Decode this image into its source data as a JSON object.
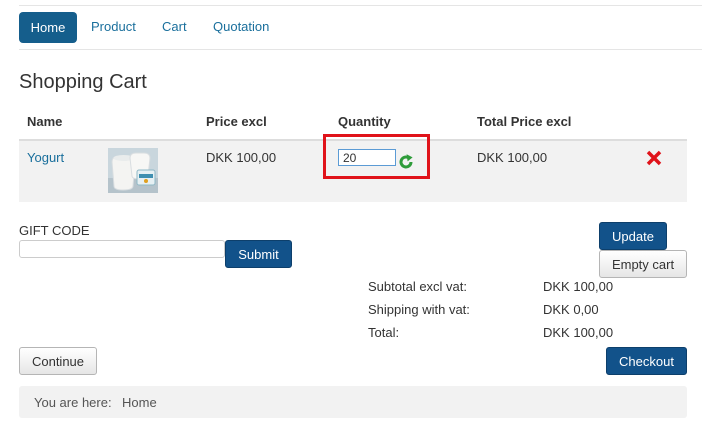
{
  "nav": {
    "items": [
      {
        "label": "Home"
      },
      {
        "label": "Product"
      },
      {
        "label": "Cart"
      },
      {
        "label": "Quotation"
      }
    ]
  },
  "page_title": "Shopping Cart",
  "table": {
    "headers": {
      "name": "Name",
      "price": "Price excl",
      "quantity": "Quantity",
      "total": "Total Price excl"
    },
    "rows": [
      {
        "name": "Yogurt",
        "image_icon": "yogurt-product-photo",
        "price": "DKK 100,00",
        "quantity": "20",
        "total": "DKK 100,00"
      }
    ]
  },
  "gift": {
    "label": "GIFT CODE",
    "value": "",
    "submit_label": "Submit"
  },
  "actions": {
    "update_label": "Update",
    "empty_label": "Empty cart",
    "continue_label": "Continue",
    "checkout_label": "Checkout"
  },
  "summary": {
    "subtotal_label": "Subtotal excl vat:",
    "subtotal_value": "DKK 100,00",
    "shipping_label": "Shipping with vat:",
    "shipping_value": "DKK 0,00",
    "total_label": "Total:",
    "total_value": "DKK 100,00"
  },
  "breadcrumb": {
    "prefix": "You are here:",
    "home": "Home"
  },
  "colors": {
    "accent": "#155e8c",
    "link": "#1a6f9c",
    "highlight_box": "#e0131a",
    "delete": "#e0131a",
    "refresh": "#2e9c3a"
  }
}
